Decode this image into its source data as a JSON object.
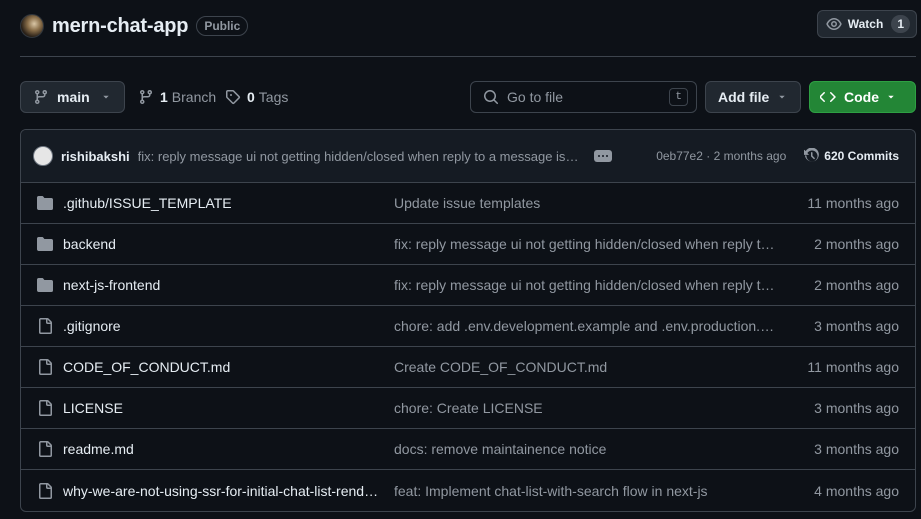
{
  "repo": {
    "name": "mern-chat-app",
    "visibility": "Public",
    "avatar_icon": "user-avatar",
    "watch_label": "Watch",
    "watch_count": "1"
  },
  "toolbar": {
    "branch": "main",
    "branch_count": "1",
    "branch_label": "Branch",
    "tag_count": "0",
    "tag_label": "Tags",
    "goto_placeholder": "Go to file",
    "goto_kbd": "t",
    "add_file": "Add file",
    "code": "Code"
  },
  "commit": {
    "author": "rishibakshi",
    "message": "fix: reply message ui not getting hidden/closed when reply to a message is sent",
    "sha": "0eb77e2",
    "age": "2 months ago",
    "sha_line": "0eb77e2 · 2 months ago",
    "commits_label": "620 Commits"
  },
  "files": [
    {
      "type": "folder",
      "name": ".github/ISSUE_TEMPLATE",
      "message": "Update issue templates",
      "age": "11 months ago"
    },
    {
      "type": "folder",
      "name": "backend",
      "message": "fix: reply message ui not getting hidden/closed when reply to a message is sent",
      "age": "2 months ago"
    },
    {
      "type": "folder",
      "name": "next-js-frontend",
      "message": "fix: reply message ui not getting hidden/closed when reply to a message is sent",
      "age": "2 months ago"
    },
    {
      "type": "file",
      "name": ".gitignore",
      "message": "chore: add .env.development.example and .env.production.example",
      "age": "3 months ago"
    },
    {
      "type": "file",
      "name": "CODE_OF_CONDUCT.md",
      "message": "Create CODE_OF_CONDUCT.md",
      "age": "11 months ago"
    },
    {
      "type": "file",
      "name": "LICENSE",
      "message": "chore: Create LICENSE",
      "age": "3 months ago"
    },
    {
      "type": "file",
      "name": "readme.md",
      "message": "docs: remove maintainence notice",
      "age": "3 months ago"
    },
    {
      "type": "file",
      "name": "why-we-are-not-using-ssr-for-initial-chat-list-rendering.md",
      "message": "feat: Implement chat-list-with-search flow in next-js",
      "age": "4 months ago"
    }
  ],
  "colors": {
    "background": "#0d1117",
    "border": "#3d444d",
    "muted_text": "#9198a1",
    "primary_text": "#e6edf3",
    "code_button": "#238636",
    "icon_folder": "#9198a1"
  }
}
